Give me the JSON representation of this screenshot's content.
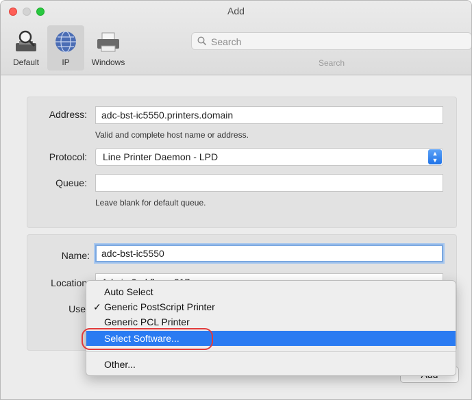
{
  "window": {
    "title": "Add"
  },
  "toolbar": {
    "tools": [
      {
        "label": "Default",
        "icon": "magnifier-printer-icon"
      },
      {
        "label": "IP",
        "icon": "globe-icon"
      },
      {
        "label": "Windows",
        "icon": "printer-icon"
      }
    ],
    "search": {
      "placeholder": "Search",
      "caption": "Search"
    }
  },
  "form1": {
    "address_label": "Address:",
    "address_value": "adc-bst-ic5550.printers.domain",
    "address_hint": "Valid and complete host name or address.",
    "protocol_label": "Protocol:",
    "protocol_value": "Line Printer Daemon - LPD",
    "queue_label": "Queue:",
    "queue_value": "",
    "queue_hint": "Leave blank for default queue."
  },
  "form2": {
    "name_label": "Name:",
    "name_value": "adc-bst-ic5550",
    "location_label": "Location:",
    "location_value": "Admin 2nd fl. rm 217",
    "use_label": "Use"
  },
  "use_menu": {
    "items": [
      {
        "label": "Auto Select",
        "checked": false
      },
      {
        "label": "Generic PostScript Printer",
        "checked": true
      },
      {
        "label": "Generic PCL Printer",
        "checked": false
      },
      {
        "label": "Select Software...",
        "checked": false,
        "highlighted": true
      },
      {
        "label": "Other...",
        "checked": false
      }
    ],
    "check_glyph": "✓"
  },
  "buttons": {
    "add_label": "Add"
  },
  "colors": {
    "accent": "#2a7bf2",
    "annotation": "#e23b3b"
  }
}
